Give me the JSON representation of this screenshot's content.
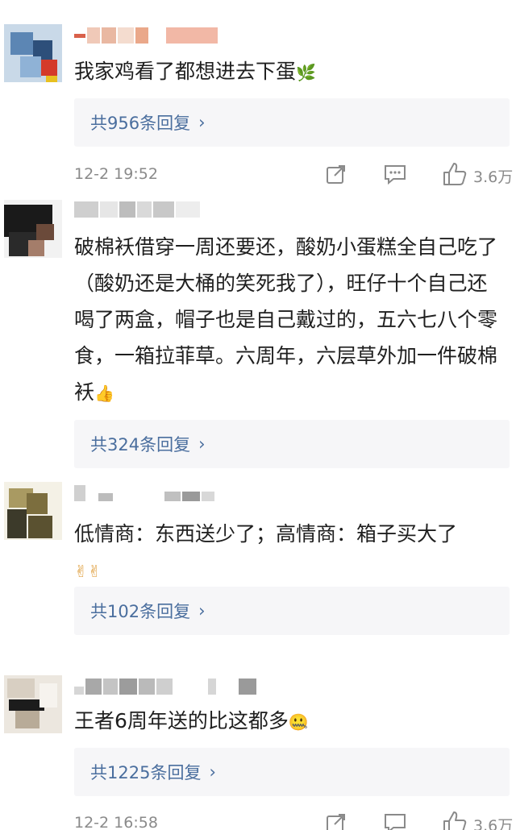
{
  "comments": [
    {
      "text": "我家鸡看了都想进去下蛋",
      "emoji": "🌿",
      "replies": "共956条回复",
      "time": "12-2 19:52",
      "likes": "3.6万"
    },
    {
      "text": "破棉袄借穿一周还要还，酸奶小蛋糕全自己吃了（酸奶还是大桶的笑死我了），旺仔十个自己还喝了两盒，帽子也是自己戴过的，五六七八个零食，一箱拉菲草。六周年，六层草外加一件破棉袄",
      "emoji": "👍",
      "replies": "共324条回复"
    },
    {
      "text": "低情商：东西送少了；高情商：箱子买大了",
      "emoji": "✌✌",
      "replies": "共102条回复"
    },
    {
      "text": "王者6周年送的比这都多",
      "emoji": "🤐",
      "replies": "共1225条回复",
      "time": "12-2 16:58",
      "likes": "3.6万"
    }
  ],
  "icons": {
    "share": "share-icon",
    "comment": "comment-icon",
    "like": "thumbs-up-icon",
    "chevron": "chevron-right-icon"
  },
  "colors": {
    "reply_link": "#4a6e9e",
    "reply_bg": "#f6f6f8",
    "meta_text": "#8a8a8a"
  },
  "chevron": "›"
}
